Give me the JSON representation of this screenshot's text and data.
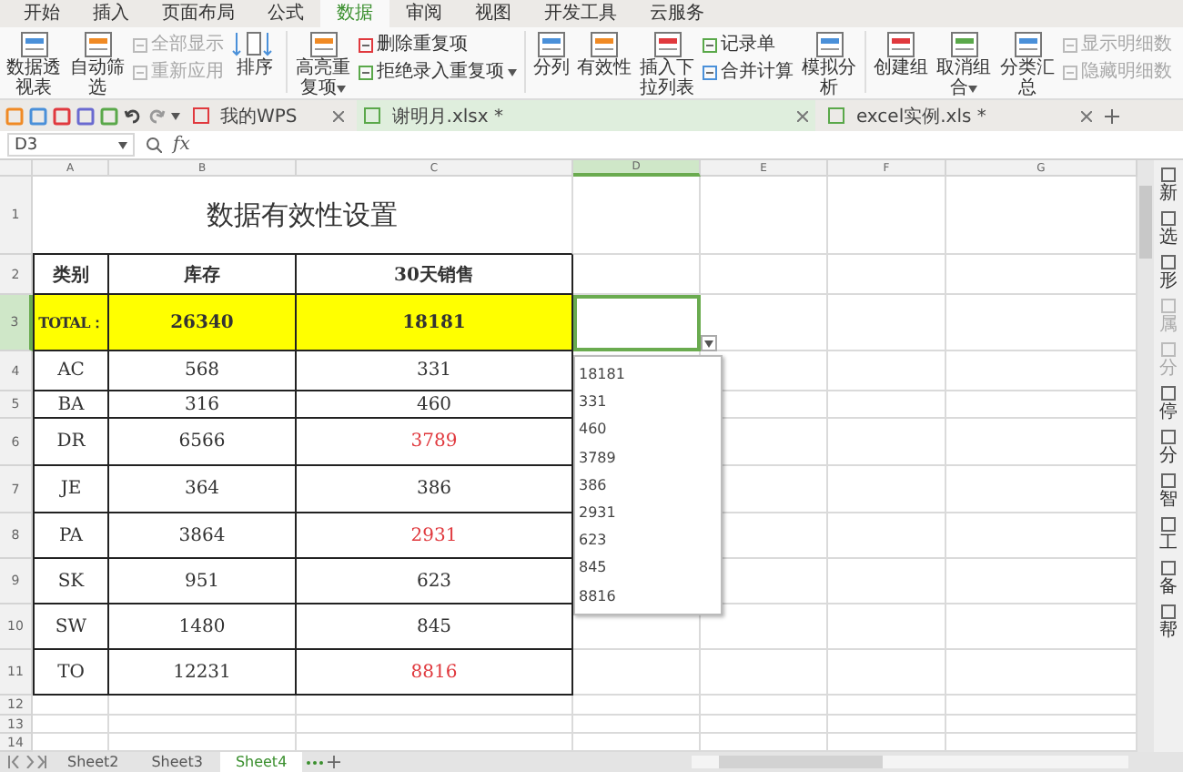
{
  "menu_tabs": [
    {
      "label": "开始",
      "selected": false
    },
    {
      "label": "插入",
      "selected": false
    },
    {
      "label": "页面布局",
      "selected": false
    },
    {
      "label": "公式",
      "selected": false
    },
    {
      "label": "数据",
      "selected": true
    },
    {
      "label": "审阅",
      "selected": false
    },
    {
      "label": "视图",
      "selected": false
    },
    {
      "label": "开发工具",
      "selected": false
    },
    {
      "label": "云服务",
      "selected": false
    }
  ],
  "ribbon": [
    {
      "kind": "large",
      "label": "数据透视表",
      "dropdown": false
    },
    {
      "kind": "large",
      "label": "自动筛选",
      "dropdown": false
    },
    {
      "kind": "stack",
      "items": [
        {
          "label": "全部显示",
          "disabled": true,
          "dropdown": false
        },
        {
          "label": "重新应用",
          "disabled": true,
          "dropdown": false
        }
      ]
    },
    {
      "kind": "sort",
      "label": "排序"
    },
    {
      "kind": "separator"
    },
    {
      "kind": "large",
      "label": "高亮重复项",
      "dropdown": true
    },
    {
      "kind": "stack",
      "items": [
        {
          "label": "删除重复项",
          "disabled": false,
          "dropdown": false
        },
        {
          "label": "拒绝录入重复项",
          "disabled": false,
          "dropdown": true
        }
      ]
    },
    {
      "kind": "separator"
    },
    {
      "kind": "large",
      "label": "分列",
      "dropdown": false
    },
    {
      "kind": "large",
      "label": "有效性",
      "dropdown": false
    },
    {
      "kind": "large",
      "label": "插入下拉列表",
      "dropdown": false
    },
    {
      "kind": "stack",
      "items": [
        {
          "label": "记录单",
          "disabled": false,
          "dropdown": false
        },
        {
          "label": "合并计算",
          "disabled": false,
          "dropdown": false
        }
      ]
    },
    {
      "kind": "large",
      "label": "模拟分析",
      "dropdown": false
    },
    {
      "kind": "separator"
    },
    {
      "kind": "large",
      "label": "创建组",
      "dropdown": false
    },
    {
      "kind": "large",
      "label": "取消组合",
      "dropdown": true
    },
    {
      "kind": "large",
      "label": "分类汇总",
      "dropdown": false
    },
    {
      "kind": "stack",
      "items": [
        {
          "label": "显示明细数",
          "disabled": true,
          "dropdown": false
        },
        {
          "label": "隐藏明细数",
          "disabled": true,
          "dropdown": false
        }
      ]
    }
  ],
  "doc_tabs": [
    {
      "label": "我的WPS",
      "selected": false
    },
    {
      "label": "谢明月.xlsx *",
      "selected": true
    },
    {
      "label": "excel实例.xls *",
      "selected": false
    }
  ],
  "formula_bar": {
    "cell_ref": "D3",
    "function_label": "fx"
  },
  "columns": [
    {
      "label": "A",
      "selected": false
    },
    {
      "label": "B",
      "selected": false
    },
    {
      "label": "C",
      "selected": false
    },
    {
      "label": "D",
      "selected": true
    },
    {
      "label": "E",
      "selected": false
    },
    {
      "label": "F",
      "selected": false
    },
    {
      "label": "G",
      "selected": false
    }
  ],
  "rows": [
    {
      "label": "1",
      "selected": false
    },
    {
      "label": "2",
      "selected": false
    },
    {
      "label": "3",
      "selected": true
    },
    {
      "label": "4",
      "selected": false
    },
    {
      "label": "5",
      "selected": false
    },
    {
      "label": "6",
      "selected": false
    },
    {
      "label": "7",
      "selected": false
    },
    {
      "label": "8",
      "selected": false
    },
    {
      "label": "9",
      "selected": false
    },
    {
      "label": "10",
      "selected": false
    },
    {
      "label": "11",
      "selected": false
    },
    {
      "label": "12",
      "selected": false
    },
    {
      "label": "13",
      "selected": false
    },
    {
      "label": "14",
      "selected": false
    }
  ],
  "sheet": {
    "title": "数据有效性设置",
    "header": [
      "类别",
      "库存",
      "30天销售"
    ],
    "total": [
      "TOTAL：",
      "26340",
      "18181"
    ],
    "items": [
      {
        "category": "AC",
        "stock": "568",
        "sales": "331",
        "color": "#333333"
      },
      {
        "category": "BA",
        "stock": "316",
        "sales": "460",
        "color": "#333333"
      },
      {
        "category": "DR",
        "stock": "6566",
        "sales": "3789",
        "color": "#e0393e"
      },
      {
        "category": "JE",
        "stock": "364",
        "sales": "386",
        "color": "#333333"
      },
      {
        "category": "PA",
        "stock": "3864",
        "sales": "2931",
        "color": "#e0393e"
      },
      {
        "category": "SK",
        "stock": "951",
        "sales": "623",
        "color": "#333333"
      },
      {
        "category": "SW",
        "stock": "1480",
        "sales": "845",
        "color": "#333333"
      },
      {
        "category": "TO",
        "stock": "12231",
        "sales": "8816",
        "color": "#e0393e"
      }
    ]
  },
  "active_cell": {
    "dropdown_open": true,
    "options": [
      "18181",
      "331",
      "460",
      "3789",
      "386",
      "2931",
      "623",
      "845",
      "8816"
    ]
  },
  "sheet_tabs": [
    {
      "label": "Sheet2",
      "selected": false
    },
    {
      "label": "Sheet3",
      "selected": false
    },
    {
      "label": "Sheet4",
      "selected": true
    }
  ],
  "side_panel": [
    {
      "label": "新",
      "disabled": false
    },
    {
      "label": "选",
      "disabled": false
    },
    {
      "label": "形",
      "disabled": false
    },
    {
      "label": "属",
      "disabled": true
    },
    {
      "label": "分",
      "disabled": true
    },
    {
      "label": "停",
      "disabled": false
    },
    {
      "label": "分",
      "disabled": false
    },
    {
      "label": "智",
      "disabled": false
    },
    {
      "label": "工",
      "disabled": false
    },
    {
      "label": "备",
      "disabled": false
    },
    {
      "label": "帮",
      "disabled": false
    }
  ]
}
